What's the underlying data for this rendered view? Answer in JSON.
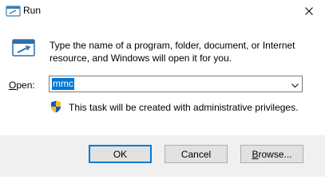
{
  "window": {
    "title": "Run",
    "close_icon": "close-icon"
  },
  "dialog": {
    "description": "Type the name of a program, folder, document, or Internet resource, and Windows will open it for you.",
    "open_label_mnemonic": "O",
    "open_label_rest": "pen:",
    "open_value": "mmc",
    "admin_notice": "This task will be created with administrative privileges."
  },
  "buttons": {
    "ok_label": "OK",
    "cancel_label": "Cancel",
    "browse_mnemonic": "B",
    "browse_rest": "rowse..."
  },
  "colors": {
    "accent": "#0078d7",
    "footer_bg": "#f0f0f0",
    "button_bg": "#e1e1e1"
  }
}
